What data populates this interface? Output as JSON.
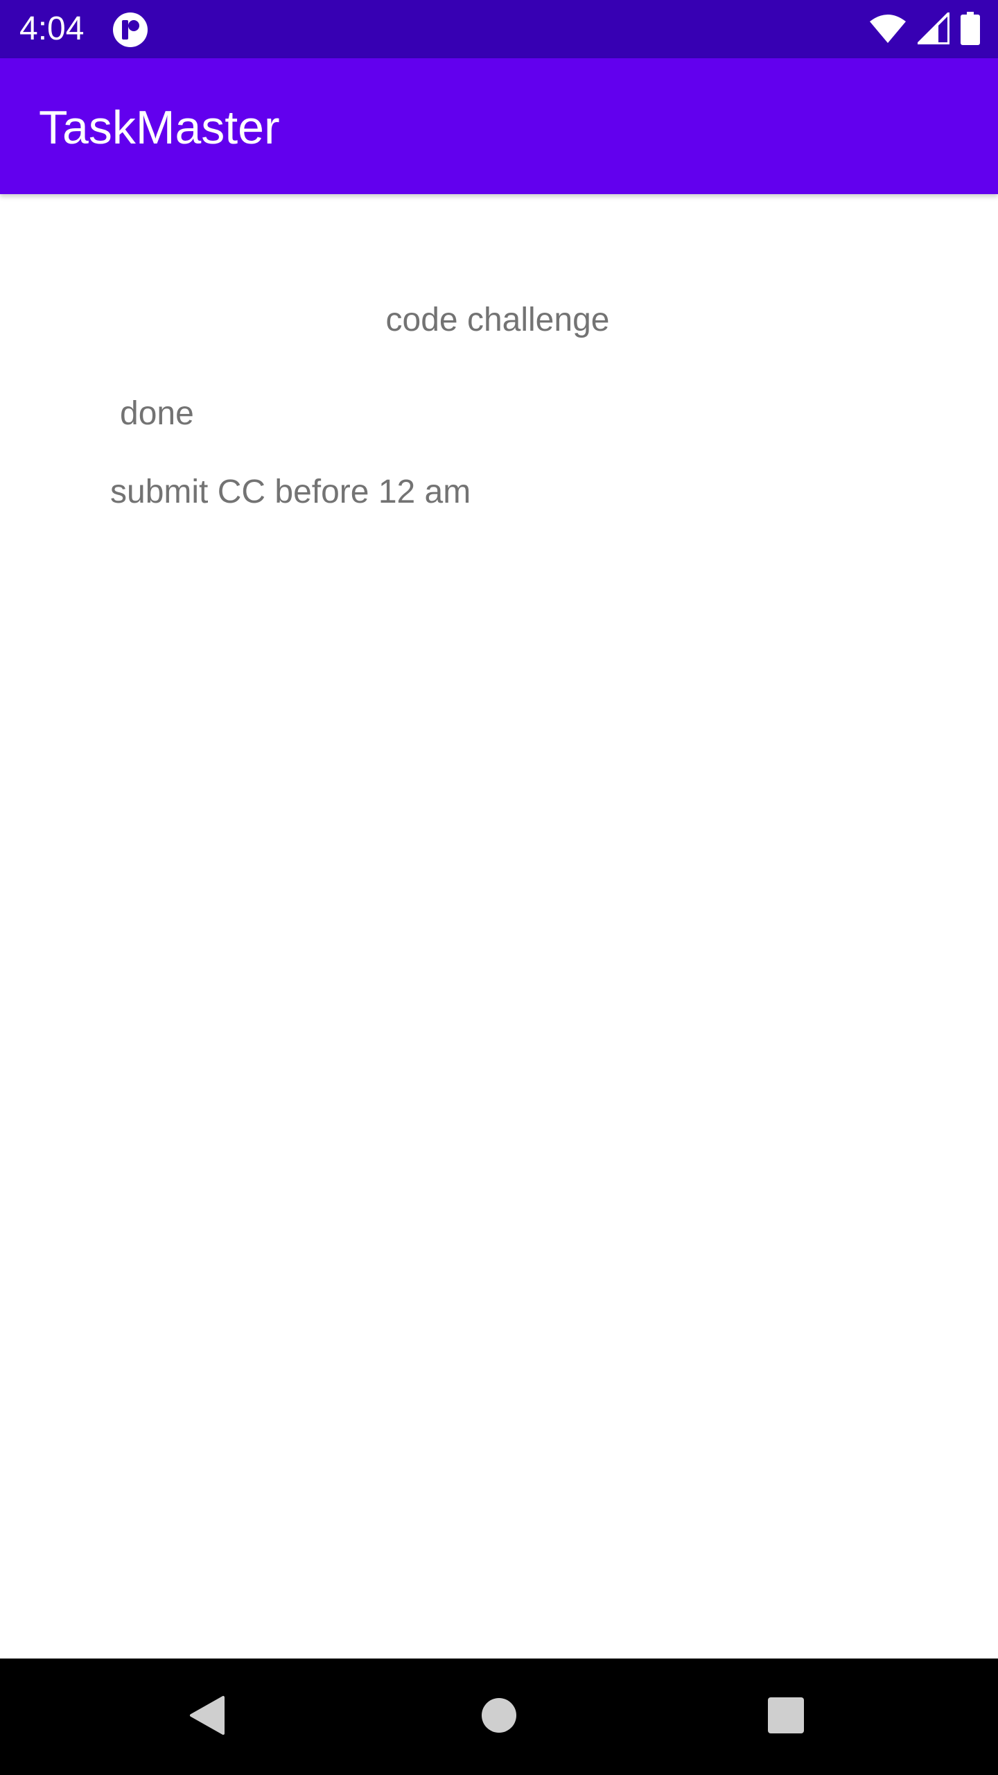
{
  "status_bar": {
    "time": "4:04",
    "app_icon": "notification-app-icon",
    "icons": [
      "wifi-icon",
      "signal-icon",
      "battery-icon"
    ],
    "background": "#3700B3"
  },
  "app_bar": {
    "title": "TaskMaster",
    "background": "#6200EE"
  },
  "task_detail": {
    "title": "code challenge",
    "state": "done",
    "body": "submit CC before 12 am",
    "text_color": "#737373"
  },
  "nav_bar": {
    "buttons": [
      "back-icon",
      "home-icon",
      "recents-icon"
    ]
  }
}
